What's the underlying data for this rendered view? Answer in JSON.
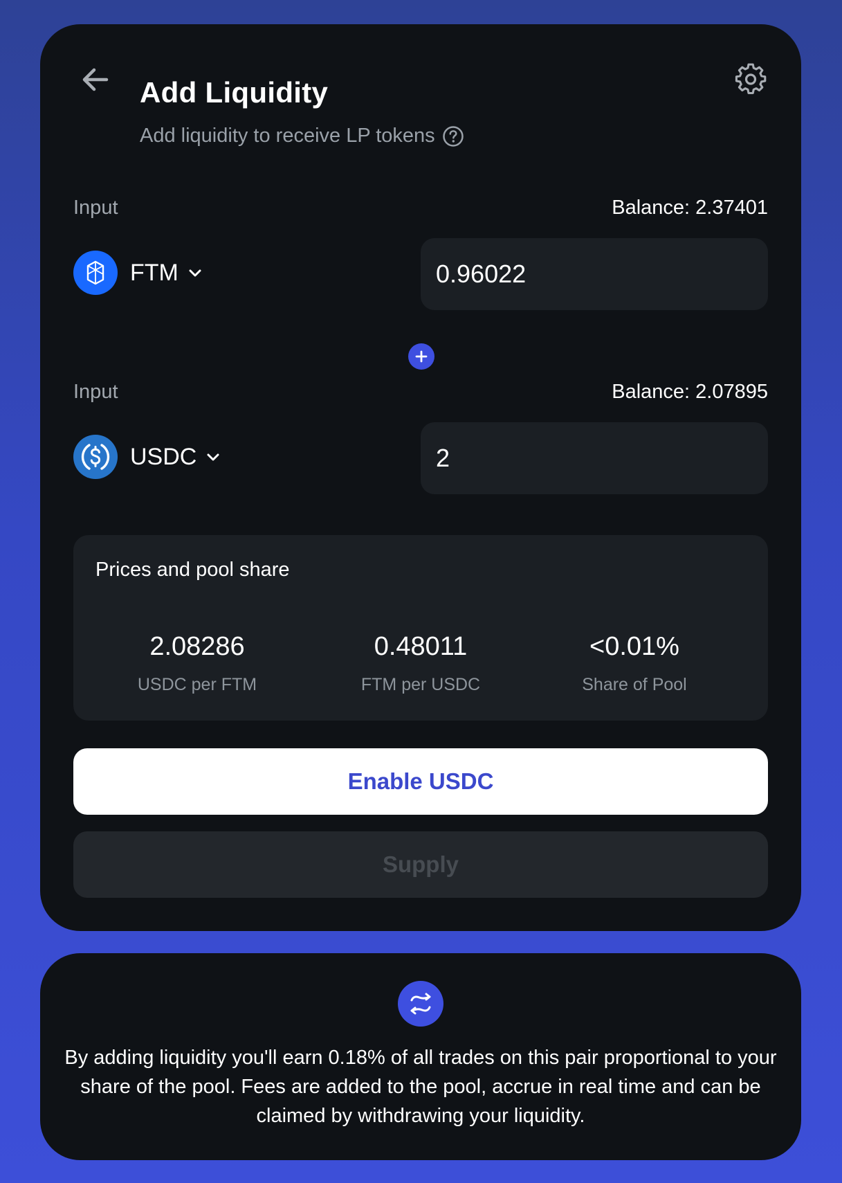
{
  "header": {
    "title": "Add Liquidity",
    "subtitle": "Add liquidity to receive LP tokens"
  },
  "inputs": [
    {
      "label": "Input",
      "balance": "Balance: 2.37401",
      "token": "FTM",
      "amount": "0.96022"
    },
    {
      "label": "Input",
      "balance": "Balance: 2.07895",
      "token": "USDC",
      "amount": "2"
    }
  ],
  "prices": {
    "title": "Prices and pool share",
    "stats": [
      {
        "value": "2.08286",
        "label": "USDC per FTM"
      },
      {
        "value": "0.48011",
        "label": "FTM per USDC"
      },
      {
        "value": "<0.01%",
        "label": "Share of Pool"
      }
    ]
  },
  "actions": {
    "enable_label": "Enable USDC",
    "supply_label": "Supply"
  },
  "info": {
    "text": "By adding liquidity you'll earn 0.18% of all trades on this pair proportional to your share of the pool. Fees are added to the pool, accrue in real time and can be claimed by withdrawing your liquidity."
  },
  "colors": {
    "accent": "#3e4fe0",
    "card_bg": "#0f1216",
    "field_bg": "#1b1f24",
    "ftm_logo": "#1969ff",
    "usdc_logo": "#2775ca"
  },
  "icons": {
    "back": "arrow-left-icon",
    "settings": "gear-icon",
    "help": "question-circle-icon",
    "plus": "plus-icon",
    "dropdown": "chevron-down-icon",
    "swap": "swap-arrows-icon"
  }
}
